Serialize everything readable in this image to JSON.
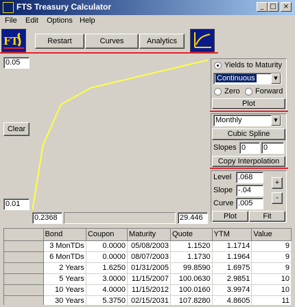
{
  "window": {
    "title": "FTS Treasury Calculator",
    "minimize": "_",
    "maximize": "□",
    "close": "×"
  },
  "menu": {
    "file": "File",
    "edit": "Edit",
    "options": "Options",
    "help": "Help"
  },
  "toolbar": {
    "restart": "Restart",
    "curves": "Curves",
    "analytics": "Analytics"
  },
  "chart_data": {
    "type": "line",
    "y_top_label": "0.05",
    "y_bottom_label": "0.01",
    "x_left_label": "0.2368",
    "x_right_label": "29.446",
    "xlim": [
      0.2368,
      29.446
    ],
    "ylim": [
      0.01,
      0.05
    ],
    "color": "#ffff40",
    "series": [
      {
        "x": [
          0.2368,
          0.5,
          2.0,
          5.0,
          10.0,
          29.446
        ],
        "y": [
          0.0101,
          0.0123,
          0.027,
          0.0376,
          0.042,
          0.0492
        ]
      }
    ]
  },
  "left": {
    "clear": "Clear"
  },
  "right": {
    "yields_label": "Yields to Maturity",
    "compounding_value": "Continuous",
    "zero_label": "Zero",
    "forward_label": "Forward",
    "plot": "Plot",
    "frequency_value": "Monthly",
    "cubic_spline": "Cubic Spline",
    "slopes_label": "Slopes",
    "slope_left": "0",
    "slope_right": "0",
    "copy_interpolation": "Copy Interpolation",
    "level_label": "Level",
    "level_value": ".068",
    "slope_label": "Slope",
    "slope_value": "-.04",
    "curve_label": "Curve",
    "curve_value": ".005",
    "plus": "+",
    "minus": "-",
    "plot2": "Plot",
    "fit": "Fit"
  },
  "table": {
    "columns": [
      "Bond",
      "Coupon",
      "Maturity",
      "Quote",
      "YTM",
      "Value"
    ],
    "rows": [
      [
        "3 MonTDs",
        "0.0000",
        "05/08/2003",
        "1.1520",
        "1.1714",
        "9"
      ],
      [
        "6 MonTDs",
        "0.0000",
        "08/07/2003",
        "1.1730",
        "1.1964",
        "9"
      ],
      [
        "2 Years",
        "1.6250",
        "01/31/2005",
        "99.8590",
        "1.6975",
        "9"
      ],
      [
        "5 Years",
        "3.0000",
        "11/15/2007",
        "100.0630",
        "2.9851",
        "10"
      ],
      [
        "10 Years",
        "4.0000",
        "11/15/2012",
        "100.0160",
        "3.9974",
        "10"
      ],
      [
        "30 Years",
        "5.3750",
        "02/15/2031",
        "107.8280",
        "4.8605",
        "11"
      ]
    ]
  }
}
